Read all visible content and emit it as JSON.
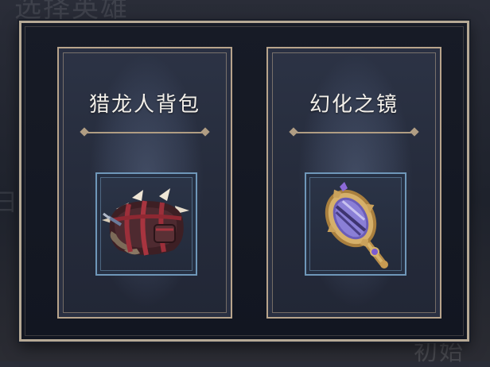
{
  "background": {
    "top_text": "选择英雄",
    "left_text": "日",
    "bottom_right_text": "初始"
  },
  "choices": [
    {
      "title": "猎龙人背包",
      "icon": "backpack-icon"
    },
    {
      "title": "幻化之镜",
      "icon": "mirror-icon"
    }
  ],
  "colors": {
    "dialog_border": "#b6a995",
    "card_bg": "#2c3345",
    "item_frame_border": "#6f97b9",
    "title_text": "#f2efe9"
  }
}
